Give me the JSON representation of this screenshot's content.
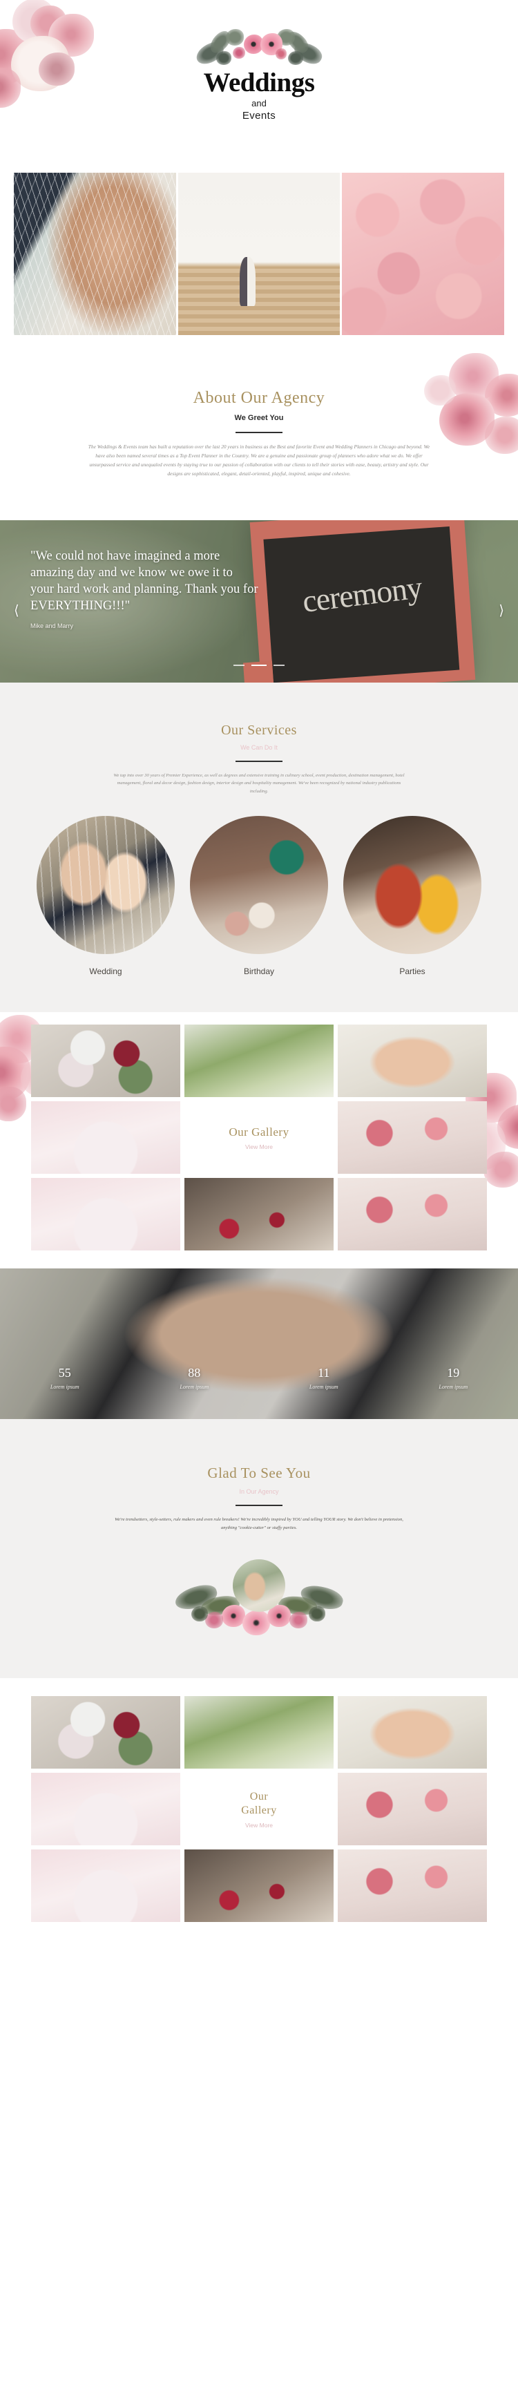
{
  "site": {
    "logo_title": "Weddings",
    "logo_and": "and",
    "logo_events": "Events"
  },
  "hero": {
    "images": [
      {
        "name": "bride-back-lace",
        "alt": "Bride in lace gown seen from behind"
      },
      {
        "name": "couple-on-steps",
        "alt": "Couple walking up steps holding hands"
      },
      {
        "name": "pink-ranunculus",
        "alt": "Bouquet of pink ranunculus flowers"
      }
    ]
  },
  "about": {
    "title": "About Our Agency",
    "subtitle": "We Greet You",
    "body": "The Weddings & Events team has built a reputation over the last 20 years in business as the Best and favorite Event and Wedding Planners in Chicago and beyond.  We have also been named several times as a Top Event Planner in the Country.  We are a genuine and passionate group of planners who adore what we do. We offer unsurpassed service and unequaled events by staying true to our passion of collaboration with our clients to tell their stories with ease, beauty, artistry and style.  Our designs are sophisticated, elegant, detail-oriented, playful, inspired, unique and cohesive."
  },
  "testimonial": {
    "quote": "\"We could not have imagined a more amazing day and we know we owe it to your hard work and planning. Thank you for EVERYTHING!!!\"",
    "author": "Mike and Marry",
    "prev_icon": "chevron-left-icon",
    "next_icon": "chevron-right-icon",
    "background_sign_text": "ceremony",
    "slide_count": 3,
    "active_slide": 2
  },
  "services": {
    "title": "Our Services",
    "subtitle": "We Can Do It",
    "body": "We tap into over 30 years of Premier Experience, as well as degrees and extensive training in culinary school, event production, destination management, hotel management,  floral and decor design, fashion design, interior design and hospitality management.  We've been recognized by national industry publications including.",
    "cards": [
      {
        "label": "Wedding",
        "image": "wedding-couple-photo"
      },
      {
        "label": "Birthday",
        "image": "dessert-table-photo"
      },
      {
        "label": "Parties",
        "image": "cocktails-photo"
      }
    ]
  },
  "gallery": {
    "title": "Our Gallery",
    "view_more": "View More",
    "tiles": [
      {
        "name": "bouquet-photo"
      },
      {
        "name": "garden-photo"
      },
      {
        "name": "lace-dress-photo"
      },
      {
        "name": "wedding-cake-photo"
      },
      {
        "name": "rose-petals-photo"
      },
      {
        "name": "reception-table-photo"
      }
    ]
  },
  "stats": {
    "items": [
      {
        "number": "55",
        "label": "Lorem ipsum"
      },
      {
        "number": "88",
        "label": "Lorem ipsum"
      },
      {
        "number": "11",
        "label": "Lorem ipsum"
      },
      {
        "number": "19",
        "label": "Lorem ipsum"
      }
    ],
    "background_image": "heart-hands-photo"
  },
  "glad": {
    "title": "Glad To See You",
    "subtitle": "In Our Agency",
    "body": "We're trendsetters, style-setters, rule makers and even rule breakers! We're incredibly inspired by YOU and telling YOUR story. We don't believe in pretension, anything \"cookie-cutter\" or stuffy parties.",
    "wreath_photo": "couple-round-photo"
  },
  "gallery2": {
    "title_line1": "Our",
    "title_line2": "Gallery",
    "view_more": "View More"
  },
  "colors": {
    "gold": "#a8915f",
    "pink": "#e8c3c8",
    "grey_bg": "#f2f1f0",
    "text_dark": "#2b2b2b"
  }
}
